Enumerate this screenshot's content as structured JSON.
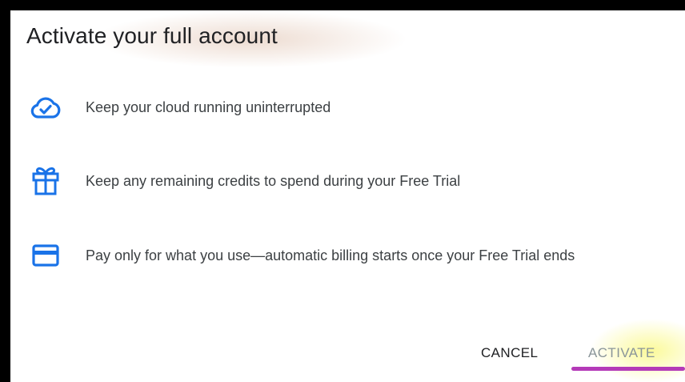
{
  "dialog": {
    "title": "Activate your full account",
    "features": [
      {
        "icon": "cloud-check-icon",
        "text": "Keep your cloud running uninterrupted"
      },
      {
        "icon": "gift-icon",
        "text": "Keep any remaining credits to spend during your Free Trial"
      },
      {
        "icon": "credit-card-icon",
        "text": "Pay only for what you use—automatic billing starts once your Free Trial ends"
      }
    ],
    "actions": {
      "cancel_label": "CANCEL",
      "activate_label": "ACTIVATE"
    }
  },
  "colors": {
    "icon_blue": "#1a73e8",
    "text": "#3c4043",
    "highlight_underline": "#b43ab8",
    "highlight_glow": "#faf878"
  }
}
